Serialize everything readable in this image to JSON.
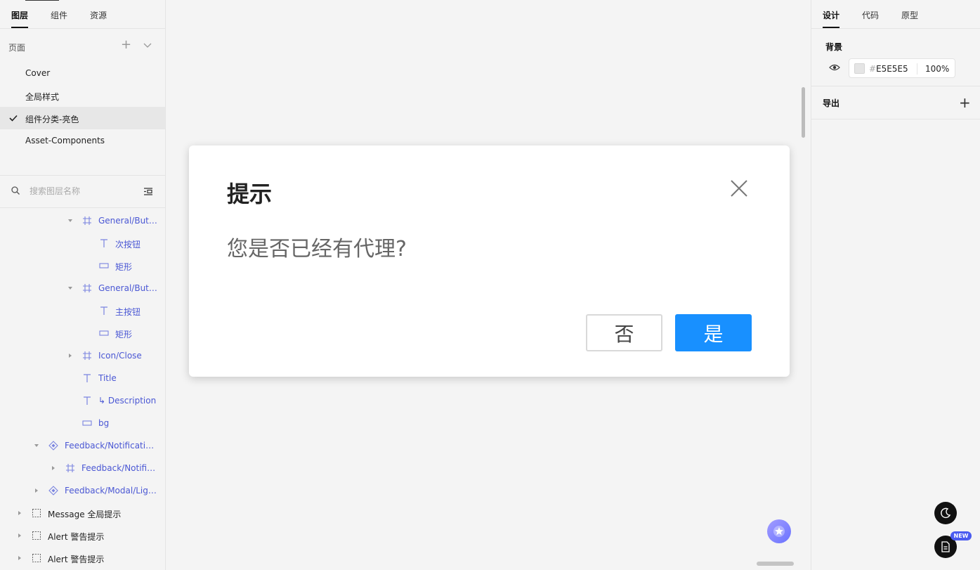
{
  "left_panel": {
    "tabs": [
      "图层",
      "组件",
      "资源"
    ],
    "pages_title": "页面",
    "pages": [
      "Cover",
      "全局样式",
      "组件分类-亮色",
      "Asset-Components"
    ],
    "active_page_index": 2,
    "search_placeholder": "搜索图层名称",
    "layers": [
      {
        "name": "General/Butt...",
        "icon": "frame-icon",
        "arrow": "expanded"
      },
      {
        "name": "次按钮",
        "icon": "text-icon",
        "arrow": "none"
      },
      {
        "name": "矩形",
        "icon": "rectangle-icon",
        "arrow": "none"
      },
      {
        "name": "General/Butt...",
        "icon": "frame-icon",
        "arrow": "expanded"
      },
      {
        "name": "主按钮",
        "icon": "text-icon",
        "arrow": "none"
      },
      {
        "name": "矩形",
        "icon": "rectangle-icon",
        "arrow": "none"
      },
      {
        "name": "Icon/Close",
        "icon": "frame-icon",
        "arrow": "collapsed"
      },
      {
        "name": "Title",
        "icon": "text-icon",
        "arrow": "none"
      },
      {
        "name": "↳ Description",
        "icon": "text-icon",
        "arrow": "none"
      },
      {
        "name": "bg",
        "icon": "rectangle-icon",
        "arrow": "none"
      },
      {
        "name": "Feedback/Notification...",
        "icon": "component-icon",
        "arrow": "expanded"
      },
      {
        "name": "Feedback/Notific...",
        "icon": "frame-icon",
        "arrow": "collapsed"
      },
      {
        "name": "Feedback/Modal/Ligh...",
        "icon": "component-icon",
        "arrow": "collapsed"
      },
      {
        "name": "Message 全局提示",
        "icon": "section-icon",
        "arrow": "collapsed"
      },
      {
        "name": "Alert 警告提示",
        "icon": "section-icon",
        "arrow": "collapsed"
      },
      {
        "name": "Alert 警告提示",
        "icon": "section-icon",
        "arrow": "collapsed"
      }
    ]
  },
  "modal": {
    "title": "提示",
    "description": "您是否已经有代理?",
    "cancel_label": "否",
    "confirm_label": "是",
    "confirm_color": "#1890FF"
  },
  "right_panel": {
    "tabs": [
      "设计",
      "代码",
      "原型"
    ],
    "background_title": "背景",
    "background_hash": "#",
    "background_hex": "E5E5E5",
    "background_opacity": "100%",
    "export_title": "导出"
  },
  "badges": {
    "new": "NEW"
  },
  "colors": {
    "accent_layer": "#4A57D4",
    "background_swatch": "#E5E5E5"
  }
}
